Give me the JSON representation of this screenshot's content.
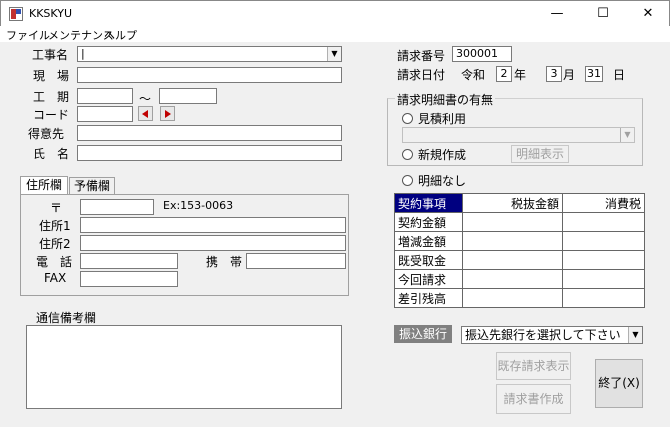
{
  "window": {
    "title": "KKSKYU",
    "minimize": "—",
    "maximize": "☐",
    "close": "✕"
  },
  "menu": [
    "ファイル",
    "メンテナンス",
    "ヘルプ"
  ],
  "left": {
    "project_label": "工事名",
    "site_label": "現　場",
    "period_label": "工　期",
    "period_sep": "～",
    "code_label": "コード",
    "customer_label": "得意先",
    "name_label": "氏　名"
  },
  "tabs": [
    "住所欄",
    "予備欄"
  ],
  "address": {
    "postal_mark": "〒",
    "postal_example": "Ex:153-0063",
    "addr1_label": "住所1",
    "addr2_label": "住所2",
    "phone_label": "電　話",
    "mobile_label": "携　帯",
    "fax_label": "FAX"
  },
  "memo_label": "通信備考欄",
  "invoice": {
    "number_label": "請求番号",
    "number_value": "300001",
    "date_label": "請求日付",
    "era": "令和",
    "year": "2",
    "year_unit": "年",
    "month": "3",
    "month_unit": "月",
    "day": "31",
    "day_unit": "日"
  },
  "detail_group": {
    "title": "請求明細書の有無",
    "use_estimate": "見積利用",
    "new_create": "新規作成",
    "show_detail_button": "明細表示",
    "no_detail": "明細なし"
  },
  "grid": {
    "headers": [
      "契約事項",
      "税抜金額",
      "消費税"
    ],
    "rows": [
      "契約金額",
      "増減金額",
      "既受取金",
      "今回請求",
      "差引残高"
    ]
  },
  "bank": {
    "label": "振込銀行",
    "placeholder": "振込先銀行を選択して下さい"
  },
  "buttons": {
    "existing_invoice": "既存請求表示",
    "create_invoice": "請求書作成",
    "exit": "終了(X)"
  },
  "colors": {
    "grid_header_bg": "#000080",
    "code_arrow": "#c00000",
    "bank_label_bg": "#808080"
  }
}
